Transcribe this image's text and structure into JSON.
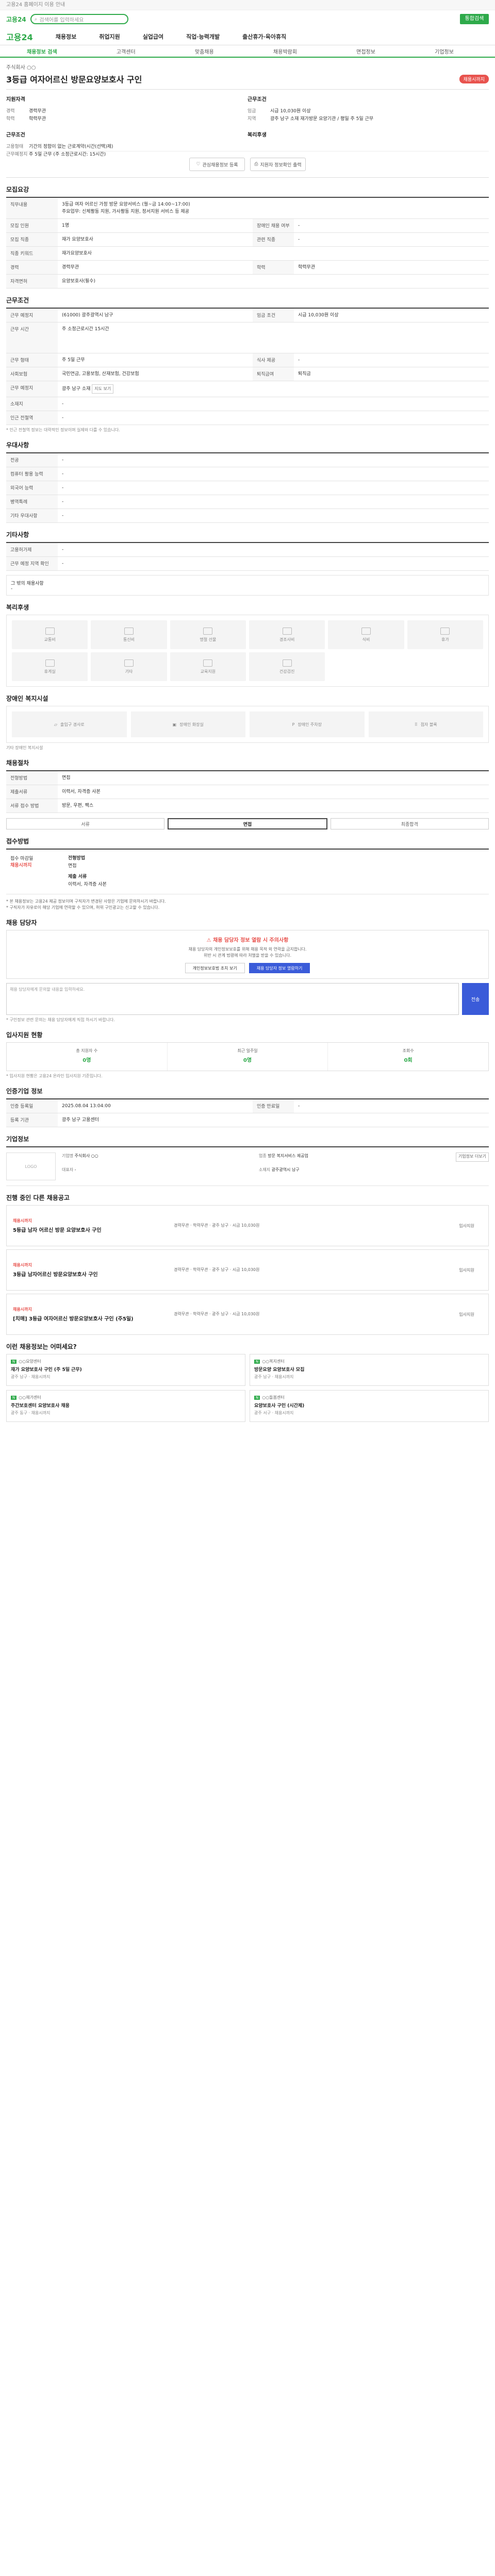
{
  "top": {
    "notice": "고용24 홈페이지 이용 안내",
    "logo": "고용24",
    "search_placeholder": "검색어를 입력하세요",
    "search_button": "통합검색"
  },
  "gnb": {
    "brand": "고용24",
    "items": [
      "채용정보",
      "취업지원",
      "실업급여",
      "직업·능력개발",
      "출산휴가·육아휴직"
    ]
  },
  "subnav": [
    "채용정보 검색",
    "고객센터",
    "맞춤채용",
    "채용박람회",
    "면접정보",
    "기업정보"
  ],
  "job": {
    "corp": "주식회사 ○○",
    "title": "3등급 여자어르신 방문요양보호사 구인",
    "dday": "채용시까지",
    "summary_left_head": "지원자격",
    "summary_left": [
      {
        "k": "경력",
        "v": "경력무관"
      },
      {
        "k": "학력",
        "v": "학력무관"
      }
    ],
    "summary_left2_head": "근무조건",
    "summary_left2": [
      {
        "k": "고용형태",
        "v": "기간의 정함이 없는 근로계약(시간(선택)제)"
      },
      {
        "k": "근무예정지",
        "v": "주 5일 근무 (주 소정근로시간: 15시간)"
      }
    ],
    "summary_right_head": "근무조건",
    "summary_right": [
      {
        "k": "임금",
        "v": "시급 10,030원 이상"
      },
      {
        "k": "지역",
        "v": "광주 남구 소재 재가방문 요양기관 / 평일 주 5일 근무"
      }
    ],
    "summary_right2_head": "복리후생",
    "scrap": "관심채용정보 등록",
    "share": "지원자 정보확인 출력"
  },
  "recruit": {
    "title": "모집요강",
    "duty_label": "직무내용",
    "duty_text": "3등급 여자 어르신 가정 방문 요양서비스 (월~금 14:00~17:00)",
    "duty_detail": "주요업무: 신체활동 지원, 가사활동 지원, 정서지원 서비스 등 제공",
    "rows": [
      {
        "k": "모집 인원",
        "v": "1명",
        "k2": "장애인 채용 여부",
        "v2": "-"
      },
      {
        "k": "모집 직종",
        "v": "재가 요양보호사",
        "k2": "관련 직종",
        "v2": "-"
      },
      {
        "k": "직종 키워드",
        "v": "재가요양보호사"
      },
      {
        "k": "경력",
        "v": "경력무관",
        "k2": "학력",
        "v2": "학력무관"
      },
      {
        "k": "자격면허",
        "v": "요양보호사(필수)"
      }
    ]
  },
  "work": {
    "title": "근무조건",
    "rows": [
      {
        "k": "근무 예정지",
        "v": "(61000) 광주광역시 남구",
        "k2": "임금 조건",
        "v2": "시급 10,030원 이상"
      },
      {
        "k": "근무 시간",
        "v": "주 소정근로시간 15시간"
      },
      {
        "k": "근무 형태",
        "v": "주 5일 근무",
        "k2": "식사 제공",
        "v2": "-"
      },
      {
        "k": "사회보험",
        "v": "국민연금, 고용보험, 산재보험, 건강보험",
        "k2": "퇴직금여",
        "v2": "퇴직금"
      },
      {
        "k": "근무 예정지",
        "v": "광주 남구 소재",
        "k2": "",
        "v2": ""
      },
      {
        "k": "소재지",
        "v": "-"
      },
      {
        "k": "인근 전철역",
        "v": "-"
      }
    ],
    "map_button": "지도 보기",
    "note": "* 인근 전철역 정보는 대략적인 정보이며 실제와 다를 수 있습니다."
  },
  "prefs": {
    "title": "우대사항",
    "rows": [
      {
        "k": "전공",
        "v": "-"
      },
      {
        "k": "컴퓨터 활용 능력",
        "v": "-"
      },
      {
        "k": "외국어 능력",
        "v": "-"
      },
      {
        "k": "병역특례",
        "v": "-"
      },
      {
        "k": "기타 우대사항",
        "v": "-"
      }
    ]
  },
  "etc": {
    "title": "기타사항",
    "rows": [
      {
        "k": "고용허가제",
        "v": "-"
      },
      {
        "k": "근무 예정 지역 확인",
        "v": "-"
      }
    ],
    "extra_label": "그 밖의 채용사항",
    "extra_value": "-"
  },
  "welfare": {
    "title": "복리후생",
    "items": [
      "교통비",
      "통신비",
      "명절 선물",
      "경조사비",
      "식비",
      "휴가",
      "휴게실",
      "기타",
      "교육지원",
      "건강검진"
    ]
  },
  "disability": {
    "title": "장애인 복지시설",
    "items": [
      "출입구 경사로",
      "장애인 화장실",
      "장애인 주차장",
      "점자 블록"
    ],
    "note_label": "기타 장애인 복지시설"
  },
  "process": {
    "title": "채용절차",
    "rows": [
      {
        "k": "전형방법",
        "v": "면접"
      },
      {
        "k": "제출서류",
        "v": "이력서, 자격증 사본"
      },
      {
        "k": "서류 접수 방법",
        "v": "방문, 우편, 팩스"
      }
    ],
    "steps": [
      "서류",
      "면접",
      "최종합격"
    ]
  },
  "apply": {
    "title": "접수방법",
    "period_label": "접수 마감일",
    "period_value": "채용시까지",
    "method_label": "전형방법",
    "method_value": "면접",
    "howto_label": "제출 서류",
    "howto_value": "이력서, 자격증 사본",
    "bullets": [
      "* 본 채용정보는 고용24 제공 정보이며 구직자가 변경된 사항은 기업에 문의하시기 바랍니다.",
      "* 구직자가 자유로이 해당 기업에 연락할 수 있으며, 허위 구인광고는 신고할 수 있습니다."
    ]
  },
  "guard": {
    "title": "채용 담당자",
    "warn": "채용 담당자 정보 열람 시 주의사항",
    "p1": "채용 담당자의 개인정보보호를 위해 채용 목적 외 연락을 금지합니다.",
    "p2": "위반 시 관계 법령에 따라 처벌을 받을 수 있습니다.",
    "btn1": "개인정보보호법 조치 보기",
    "btn2": "채용 담당자 정보 열람하기",
    "ta_placeholder": "채용 담당자에게 문의할 내용을 입력하세요.",
    "submit": "전송",
    "foot": "* 구인정보 관련 문의는 채용 담당자에게 직접 하시기 바랍니다."
  },
  "stats": {
    "title": "입사지원 현황",
    "items": [
      {
        "label": "총 지원자 수",
        "value": "0명"
      },
      {
        "label": "최근 일주일",
        "value": "0명"
      },
      {
        "label": "조회수",
        "value": "0회"
      }
    ],
    "note": "* 입사지원 현황은 고용24 온라인 입사지원 기준입니다."
  },
  "manage": {
    "title": "인증기업 정보",
    "rows": [
      {
        "k": "인증 등록일",
        "v": "2025.08.04 13:04:00",
        "k2": "인증 만료일",
        "v2": "-"
      },
      {
        "k": "등록 기관",
        "v": "광주 남구 고용센터",
        "k2": "",
        "v2": ""
      }
    ]
  },
  "company": {
    "title": "기업정보",
    "logo": "LOGO",
    "rows": [
      {
        "k": "기업명",
        "v": "주식회사 ○○"
      },
      {
        "k": "업종",
        "v": "방문 복지서비스 제공업"
      },
      {
        "k": "대표자",
        "v": "-"
      },
      {
        "k": "소재지",
        "v": "광주광역시 남구"
      }
    ],
    "more": "기업정보 더보기"
  },
  "others": {
    "title": "진행 중인 다른 채용공고",
    "items": [
      {
        "tag": "채용시까지",
        "title": "5등급 남자 어르신 방문 요양보호사 구인",
        "info": "경력무관 · 학력무관 · 광주 남구 · 시급 10,030원",
        "label": "입사지원"
      },
      {
        "tag": "채용시까지",
        "title": "3등급 남자어르신 방문요양보호사 구인",
        "info": "경력무관 · 학력무관 · 광주 남구 · 시급 10,030원",
        "label": "입사지원"
      },
      {
        "tag": "채용시까지",
        "title": "[치매] 3등급 여자어르신 방문요양보호사 구인 (주5일)",
        "info": "경력무관 · 학력무관 · 광주 남구 · 시급 10,030원",
        "label": "입사지원"
      }
    ]
  },
  "recs": {
    "title": "이런 채용정보는 어떠세요?",
    "items": [
      {
        "corp": "○○요양센터",
        "title": "재가 요양보호사 구인 (주 5일 근무)",
        "info": "광주 남구 · 채용시까지"
      },
      {
        "corp": "○○복지센터",
        "title": "방문요양 요양보호사 모집",
        "info": "광주 남구 · 채용시까지"
      },
      {
        "corp": "○○재가센터",
        "title": "주간보호센터 요양보호사 채용",
        "info": "광주 동구 · 채용시까지"
      },
      {
        "corp": "○○돌봄센터",
        "title": "요양보호사 구인 (시간제)",
        "info": "광주 서구 · 채용시까지"
      }
    ]
  }
}
